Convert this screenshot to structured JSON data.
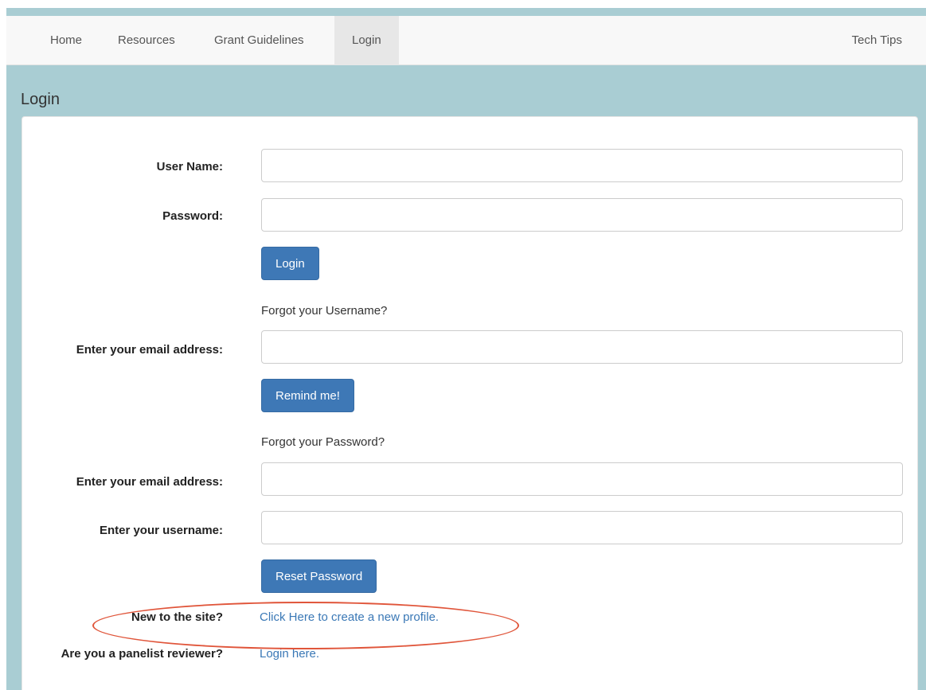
{
  "nav": {
    "items": [
      {
        "label": "Home"
      },
      {
        "label": "Resources"
      },
      {
        "label": "Grant Guidelines"
      },
      {
        "label": "Login",
        "active": true
      }
    ],
    "right_label": "Tech Tips"
  },
  "page": {
    "title": "Login"
  },
  "login_form": {
    "username_label": "User Name:",
    "username_value": "",
    "password_label": "Password:",
    "password_value": "",
    "login_button": "Login"
  },
  "forgot_username": {
    "heading": "Forgot your Username?",
    "email_label": "Enter your email address:",
    "email_value": "",
    "button": "Remind me!"
  },
  "forgot_password": {
    "heading": "Forgot your Password?",
    "email_label": "Enter your email address:",
    "email_value": "",
    "username_label": "Enter your username:",
    "username_value": "",
    "button": "Reset Password"
  },
  "new_user": {
    "label": "New to the site?",
    "link": "Click Here to create a new profile."
  },
  "panelist": {
    "label": "Are you a panelist reviewer?",
    "link": "Login here."
  },
  "colors": {
    "page_bg": "#a9cdd3",
    "primary_button": "#3e78b6",
    "link": "#3a78b6",
    "annotation": "#e0553a"
  }
}
